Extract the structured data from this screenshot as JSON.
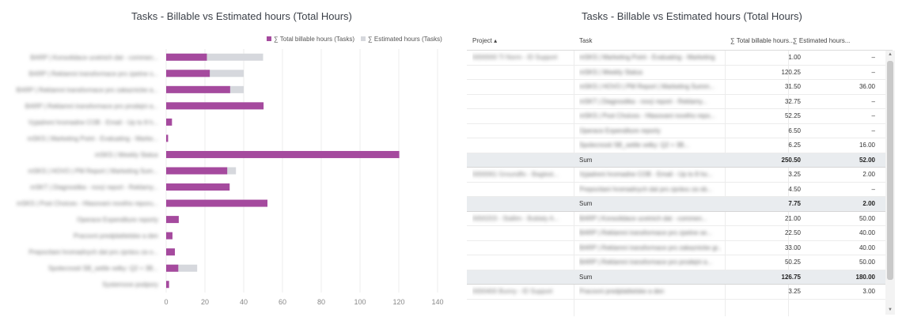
{
  "left_panel": {
    "title": "Tasks - Billable vs Estimated hours (Total Hours)"
  },
  "right_panel": {
    "title": "Tasks - Billable vs Estimated hours (Total Hours)"
  },
  "colors": {
    "billable": "#a54a9e",
    "estimated": "#d6d8dd",
    "grid": "#eeeeee",
    "sum_row": "#e9ecef"
  },
  "chart_data": {
    "type": "bar",
    "orientation": "horizontal",
    "stacked": "overlay",
    "categories": [
      "BARP | Konsolidace ucetnich dat - commen...",
      "BARP | Reklamni transformace pro zpetne s...",
      "BARP | Reklamni transformace pro zakaznicke a...",
      "BARP | Reklamni transformace pro prodejni a...",
      "Vyjadreni hromadne COB - Email - Up to 8 h...",
      "mSKS | Marketing Point - Evaluating - Marke...",
      "mSKS | Weekly Status",
      "mSKS | HOVO | PM Report | Marketing Sum...",
      "mSKT | Diagnostika - nový report - Reklamy...",
      "mSKS | Post Choices - Hlasovani nového reporu...",
      "Operace Expenditure reporty",
      "Pracovni predplatitelske a den",
      "Prepocitani hromadnych dat pro zprávu za o...",
      "Spolecnosti SB_settle velky: Q2 + 3B...",
      "Systemove podpory"
    ],
    "series": [
      {
        "name": "∑ Total billable hours (Tasks)",
        "values": [
          21,
          22.5,
          33,
          50.25,
          3,
          1,
          120.25,
          31.5,
          32.75,
          52.25,
          6.5,
          3.25,
          4.5,
          6.25,
          1.5
        ]
      },
      {
        "name": "∑ Estimated hours (Tasks)",
        "values": [
          50,
          40,
          40,
          50,
          0,
          0,
          0,
          36,
          0,
          0,
          0,
          0,
          0,
          16,
          0
        ]
      }
    ],
    "x_ticks": [
      0,
      20,
      40,
      60,
      80,
      100,
      120,
      140
    ],
    "xlim": [
      0,
      140
    ],
    "grid": true,
    "legend_position": "top-right"
  },
  "table": {
    "headers": {
      "project": "Project ▴",
      "task": "Task",
      "billable": "∑ Total billable hours...",
      "estimated": "∑ Estimated hours..."
    },
    "rows": [
      {
        "project": "0000000 TI Norm - ID Support",
        "task": "mSKS | Marketing Point - Evaluating - Marketing",
        "billable": "1.00",
        "estimated": "–",
        "sum": false
      },
      {
        "project": "",
        "task": "mSKS | Weekly Status",
        "billable": "120.25",
        "estimated": "–",
        "sum": false
      },
      {
        "project": "",
        "task": "mSKS | HOVO | PM Report | Marketing Summ...",
        "billable": "31.50",
        "estimated": "36.00",
        "sum": false
      },
      {
        "project": "",
        "task": "mSKT | Diagnostika - nový report - Reklamy...",
        "billable": "32.75",
        "estimated": "–",
        "sum": false
      },
      {
        "project": "",
        "task": "mSKS | Post Choices - Hlasovani nového repo...",
        "billable": "52.25",
        "estimated": "–",
        "sum": false
      },
      {
        "project": "",
        "task": "Operace Expenditure reporty",
        "billable": "6.50",
        "estimated": "–",
        "sum": false
      },
      {
        "project": "",
        "task": "Spolecnosti SB_settle velky: Q2 + 3B...",
        "billable": "6.25",
        "estimated": "16.00",
        "sum": false
      },
      {
        "project": "",
        "task": "Sum",
        "billable": "250.50",
        "estimated": "52.00",
        "sum": true
      },
      {
        "project": "0000061 Groundfix - Bagtest...",
        "task": "Vyjadreni hromadne COB - Email - Up to 8 ho...",
        "billable": "3.25",
        "estimated": "2.00",
        "sum": false
      },
      {
        "project": "",
        "task": "Prepocitani hromadnych dat pro zprávu za ob...",
        "billable": "4.50",
        "estimated": "–",
        "sum": false
      },
      {
        "project": "",
        "task": "Sum",
        "billable": "7.75",
        "estimated": "2.00",
        "sum": true
      },
      {
        "project": "0000203 - Stallim - Bublaly A...",
        "task": "BARP | Konsolidace ucetnich dat - commen...",
        "billable": "21.00",
        "estimated": "50.00",
        "sum": false
      },
      {
        "project": "",
        "task": "BARP | Reklamni transformace pro zpetne se...",
        "billable": "22.50",
        "estimated": "40.00",
        "sum": false
      },
      {
        "project": "",
        "task": "BARP | Reklamni transformace pro zakaznicke gr...",
        "billable": "33.00",
        "estimated": "40.00",
        "sum": false
      },
      {
        "project": "",
        "task": "BARP | Reklamni transformace pro prodejni a...",
        "billable": "50.25",
        "estimated": "50.00",
        "sum": false
      },
      {
        "project": "",
        "task": "Sum",
        "billable": "126.75",
        "estimated": "180.00",
        "sum": true
      },
      {
        "project": "0000400 Bunny - ID Support",
        "task": "Pracovni predplatitelske a den",
        "billable": "3.25",
        "estimated": "3.00",
        "sum": false
      }
    ]
  }
}
